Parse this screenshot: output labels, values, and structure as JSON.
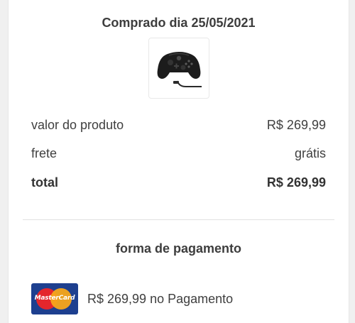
{
  "purchase": {
    "date_label": "Comprado dia 25/05/2021",
    "product_image": "xbox-controller-with-cable"
  },
  "summary": {
    "product_value_label": "valor do produto",
    "product_value": "R$ 269,99",
    "shipping_label": "frete",
    "shipping_value": "grátis",
    "total_label": "total",
    "total_value": "R$ 269,99"
  },
  "payment": {
    "title": "forma de pagamento",
    "card_brand_text": "MasterCard",
    "description": "R$ 269,99 no Pagamento"
  },
  "colors": {
    "card_blue": "#1d3f8f",
    "mc_red": "#e4262c",
    "mc_yellow": "#f7a61b"
  }
}
